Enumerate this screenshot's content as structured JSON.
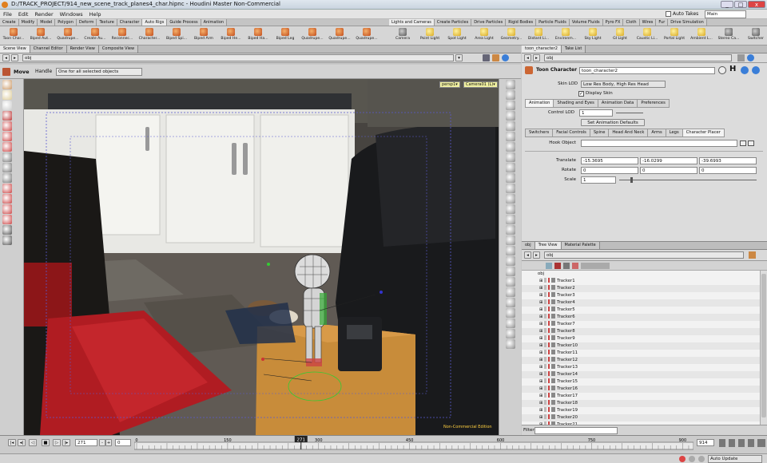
{
  "window": {
    "title": "D:/TRACK_PROJECT/914_new_scene_track_planes4_char.hipnc - Houdini Master Non-Commercial",
    "auto_takes": "Auto Takes",
    "desktop": "Main"
  },
  "menu": [
    "File",
    "Edit",
    "Render",
    "Windows",
    "Help"
  ],
  "shelf_tabs_left": [
    "Create",
    "Modify",
    "Model",
    "Polygon",
    "Deform",
    "Texture",
    "Character",
    "Auto Rigs",
    "Guide Process",
    "Animation"
  ],
  "shelf_tabs_right": [
    "Lights and Cameras",
    "Create Particles",
    "Drive Particles",
    "Rigid Bodies",
    "Particle Fluids",
    "Volume Fluids",
    "Pyro FX",
    "Cloth",
    "Wires",
    "Fur",
    "Drive Simulation"
  ],
  "shelf_tools_left": [
    "Toon Char...",
    "Biped Aut...",
    "Quadrupe...",
    "Create Au...",
    "Reconnec...",
    "Character...",
    "Biped Spi...",
    "Biped Arm",
    "Biped He...",
    "Biped Ha...",
    "Biped Leg",
    "Quadrupe...",
    "Quadrupe...",
    "Quadrupe..."
  ],
  "shelf_tools_right": [
    "Camera",
    "Point Light",
    "Spot Light",
    "Area Light",
    "Geometry...",
    "Distant Li...",
    "Environm...",
    "Sky Light",
    "GI Light",
    "Caustic Li...",
    "Portal Light",
    "Ambient L...",
    "Stereo Ca...",
    "Switcher"
  ],
  "left_pane": {
    "tabs": [
      "Scene View",
      "Channel Editor",
      "Render View",
      "Composite View"
    ],
    "path": "obj",
    "tool_name": "Move",
    "handle_label": "Handle",
    "handle_mode": "One for all selected objects",
    "persp": "persp1▾",
    "camera": "Camera01 (L)▾",
    "watermark": "Non-Commercial Edition"
  },
  "params": {
    "tabs": [
      "toon_character2",
      "Take List"
    ],
    "path": "obj",
    "node_type": "Toon Character",
    "node_name": "toon_character2",
    "skin_lod_label": "Skin LOD",
    "skin_lod": "Low Res Body, High Res Head",
    "display_skin": "Display Skin",
    "main_tabs": [
      "Animation",
      "Shading and Eyes",
      "Animation Data",
      "Preferences"
    ],
    "control_lod_label": "Control LOD",
    "control_lod": "1",
    "set_defaults": "Set Animation Defaults",
    "sub_tabs": [
      "Switchers",
      "Facial Controls",
      "Spine",
      "Head And Neck",
      "Arms",
      "Legs",
      "Character Placer"
    ],
    "hook_label": "Hook Object",
    "translate_label": "Translate",
    "translate": [
      "-15.3695",
      "-16.0299",
      "-39.6993"
    ],
    "rotate_label": "Rotate",
    "rotate": [
      "0",
      "0",
      "0"
    ],
    "scale_label": "Scale",
    "scale": "1"
  },
  "tree": {
    "tabs": [
      "obj",
      "Tree View",
      "Material Palette"
    ],
    "path": "obj",
    "root": "obj",
    "items": [
      "Tracker1",
      "Tracker2",
      "Tracker3",
      "Tracker4",
      "Tracker5",
      "Tracker6",
      "Tracker7",
      "Tracker8",
      "Tracker9",
      "Tracker10",
      "Tracker11",
      "Tracker12",
      "Tracker13",
      "Tracker14",
      "Tracker15",
      "Tracker16",
      "Tracker17",
      "Tracker18",
      "Tracker19",
      "Tracker20",
      "Tracker21"
    ],
    "filter_label": "Filter"
  },
  "timeline": {
    "current_frame": "271",
    "start": "0",
    "end": "914",
    "ticks": [
      "0",
      "150",
      "300",
      "450",
      "600",
      "750",
      "900"
    ],
    "marker": "271",
    "auto_update": "Auto Update"
  },
  "colors": {
    "shelf_tab_sel": "#ececec",
    "accent": "#f0f0a0"
  }
}
